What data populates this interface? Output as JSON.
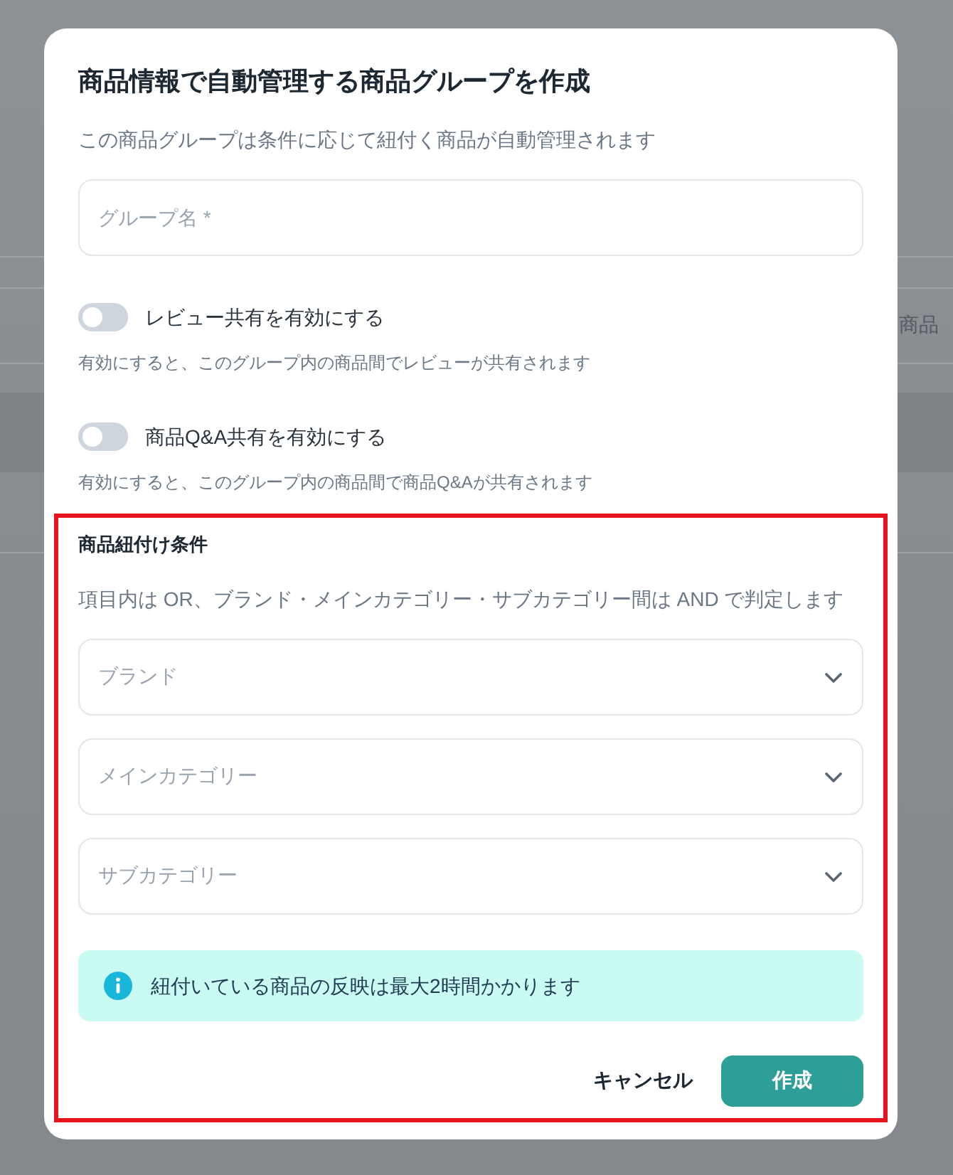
{
  "background_page": {
    "column_header": "商品"
  },
  "dialog": {
    "title": "商品情報で自動管理する商品グループを作成",
    "subtitle": "この商品グループは条件に応じて紐付く商品が自動管理されます"
  },
  "group_name_field": {
    "placeholder": "グループ名 *"
  },
  "toggles": [
    {
      "label": "レビュー共有を有効にする",
      "help": "有効にすると、このグループ内の商品間でレビューが共有されます",
      "on": false
    },
    {
      "label": "商品Q&A共有を有効にする",
      "help": "有効にすると、このグループ内の商品間で商品Q&Aが共有されます",
      "on": false
    }
  ],
  "conditions": {
    "highlighted": true,
    "title": "商品紐付け条件",
    "description": "項目内は OR、ブランド・メインカテゴリー・サブカテゴリー間は AND で判定します",
    "selects": [
      {
        "placeholder": "ブランド"
      },
      {
        "placeholder": "メインカテゴリー"
      },
      {
        "placeholder": "サブカテゴリー"
      }
    ],
    "notice": "紐付いている商品の反映は最大2時間かかります"
  },
  "buttons": [
    {
      "label": "キャンセル",
      "kind": "text"
    },
    {
      "label": "作成",
      "kind": "primary"
    }
  ]
}
